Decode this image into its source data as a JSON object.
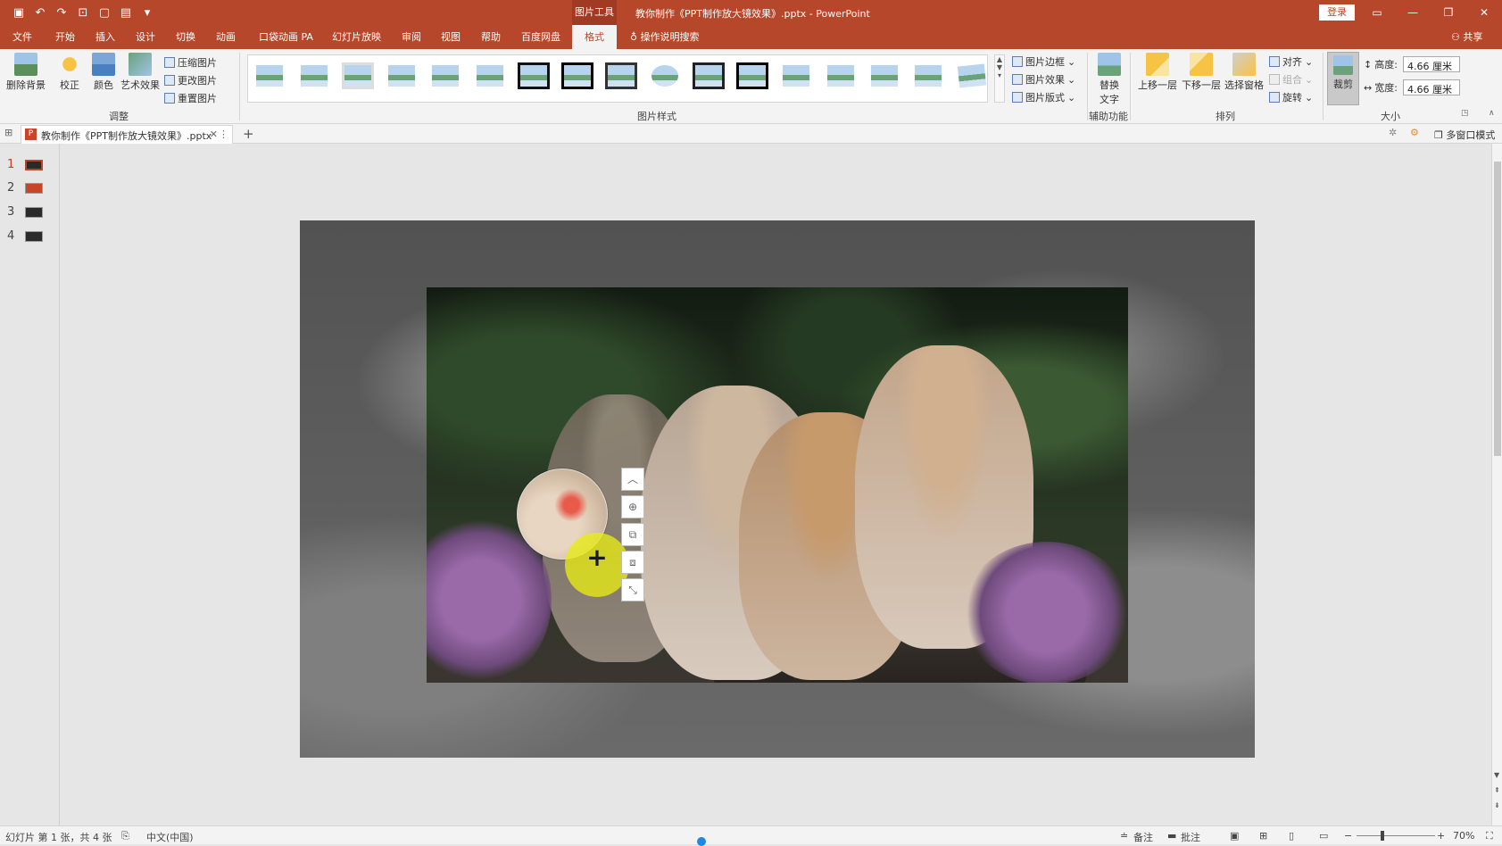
{
  "app": {
    "context_tab_label": "图片工具",
    "document_title": "教你制作《PPT制作放大镜效果》.pptx - PowerPoint",
    "login_label": "登录"
  },
  "menu": {
    "items": [
      "文件",
      "开始",
      "插入",
      "设计",
      "切换",
      "动画",
      "口袋动画 PA",
      "幻灯片放映",
      "审阅",
      "视图",
      "帮助",
      "百度网盘",
      "格式"
    ],
    "active": "格式",
    "tell_me": "操作说明搜索",
    "share": "共享"
  },
  "ribbon": {
    "remove_bg": "删除背景",
    "corrections": "校正",
    "color": "颜色",
    "artistic": "艺术效果",
    "compress": "压缩图片",
    "change_pic": "更改图片",
    "reset_pic": "重置图片",
    "group_adjust": "调整",
    "group_styles": "图片样式",
    "pic_border": "图片边框",
    "pic_effects": "图片效果",
    "pic_layout": "图片版式",
    "alt_text_line1": "替换",
    "alt_text_line2": "文字",
    "group_access": "辅助功能",
    "bring_forward": "上移一层",
    "send_backward": "下移一层",
    "selection_pane": "选择窗格",
    "align": "对齐",
    "group_obj": "组合",
    "rotate": "旋转",
    "group_arrange": "排列",
    "crop": "裁剪",
    "height_label": "高度:",
    "height_value": "4.66 厘米",
    "width_label": "宽度:",
    "width_value": "4.66 厘米",
    "group_size": "大小"
  },
  "docbar": {
    "tab_title": "教你制作《PPT制作放大镜效果》.pptx",
    "multiwindow": "多窗口模式"
  },
  "slides": {
    "numbers": [
      "1",
      "2",
      "3",
      "4"
    ],
    "active_index": 0
  },
  "status": {
    "slide_info": "幻灯片 第 1 张，共 4 张",
    "language": "中文(中国)",
    "notes": "备注",
    "comments": "批注",
    "zoom": "70%"
  },
  "colors": {
    "accent": "#b7472a",
    "halo": "#e8ec14"
  }
}
